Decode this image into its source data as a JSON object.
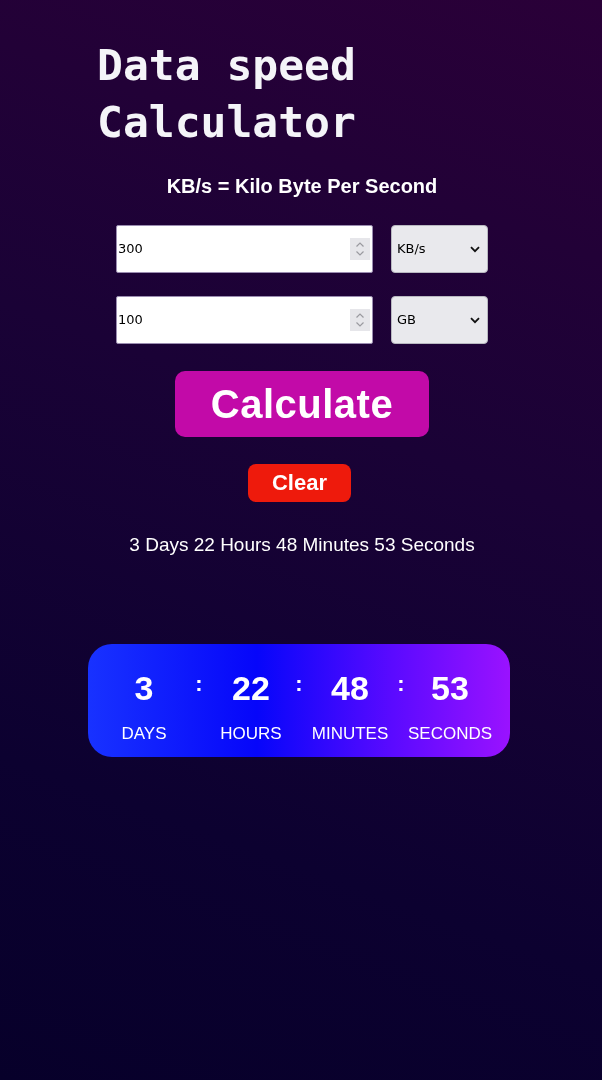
{
  "title": "Data speed Calculator",
  "subtitle": "KB/s = Kilo Byte Per Second",
  "fields": [
    {
      "value": "300",
      "unit": "KB/s"
    },
    {
      "value": "100",
      "unit": "GB"
    }
  ],
  "buttons": [
    {
      "label": "Calculate",
      "kind": "primary"
    },
    {
      "label": "Clear",
      "kind": "danger"
    }
  ],
  "result": "3 Days 22 Hours 48 Minutes 53 Seconds",
  "countdown": {
    "units": [
      {
        "value": "3",
        "label": "DAYS"
      },
      {
        "value": "22",
        "label": "HOURS"
      },
      {
        "value": "48",
        "label": "MINUTES"
      },
      {
        "value": "53",
        "label": "SECONDS"
      }
    ],
    "separators": [
      ":",
      ":",
      ":"
    ]
  }
}
